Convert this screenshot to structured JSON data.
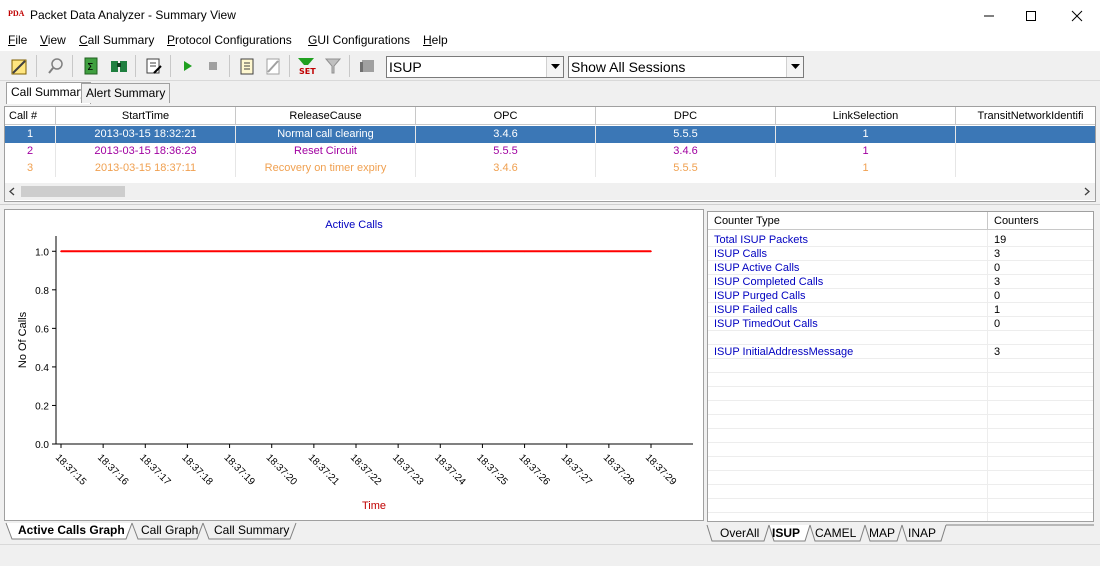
{
  "window": {
    "app_icon": "PDA",
    "title": "Packet Data Analyzer - Summary View"
  },
  "menu": [
    "File",
    "View",
    "Call Summary",
    "Protocol Configurations",
    "GUI Configurations",
    "Help"
  ],
  "toolbar": {
    "protocol_select": "ISUP",
    "session_select": "Show All Sessions"
  },
  "top_tabs": [
    "Call Summary",
    "Alert Summary"
  ],
  "call_table": {
    "columns": [
      "Call #",
      "StartTime",
      "ReleaseCause",
      "OPC",
      "DPC",
      "LinkSelection",
      "TransitNetworkIdentifi"
    ],
    "rows": [
      {
        "num": "1",
        "start": "2013-03-15 18:32:21",
        "cause": "Normal call clearing",
        "opc": "3.4.6",
        "dpc": "5.5.5",
        "link": "1",
        "color": "#ffffff"
      },
      {
        "num": "2",
        "start": "2013-03-15 18:36:23",
        "cause": "Reset Circuit",
        "opc": "5.5.5",
        "dpc": "3.4.6",
        "link": "1",
        "color": "#a000a0"
      },
      {
        "num": "3",
        "start": "2013-03-15 18:37:11",
        "cause": "Recovery on timer expiry",
        "opc": "3.4.6",
        "dpc": "5.5.5",
        "link": "1",
        "color": "#f0a050"
      }
    ]
  },
  "chart_data": {
    "type": "line",
    "title": "Active Calls",
    "xlabel": "Time",
    "ylabel": "No Of Calls",
    "x": [
      "18:37:15",
      "18:37:16",
      "18:37:17",
      "18:37:18",
      "18:37:19",
      "18:37:20",
      "18:37:21",
      "18:37:22",
      "18:37:23",
      "18:37:24",
      "18:37:25",
      "18:37:26",
      "18:37:27",
      "18:37:28",
      "18:37:29"
    ],
    "series": [
      {
        "values": [
          1,
          1,
          1,
          1,
          1,
          1,
          1,
          1,
          1,
          1,
          1,
          1,
          1,
          1,
          1
        ]
      }
    ],
    "yticks": [
      "0.0",
      "0.2",
      "0.4",
      "0.6",
      "0.8",
      "1.0"
    ],
    "ylim": [
      0,
      1.1
    ],
    "line_color": "#ff0000",
    "title_color": "#0000c0",
    "xlabel_color": "#c00000",
    "grid": false
  },
  "graph_tabs": [
    "Active Calls Graph",
    "Call Graph",
    "Call Summary"
  ],
  "counters": {
    "headers": [
      "Counter Type",
      "Counters"
    ],
    "rows": [
      {
        "type": "Total ISUP Packets",
        "value": "19"
      },
      {
        "type": "ISUP Calls",
        "value": "3"
      },
      {
        "type": "ISUP Active Calls",
        "value": "0"
      },
      {
        "type": "ISUP Completed Calls",
        "value": "3"
      },
      {
        "type": "ISUP Purged Calls",
        "value": "0"
      },
      {
        "type": "ISUP Failed calls",
        "value": "1"
      },
      {
        "type": "ISUP TimedOut Calls",
        "value": "0"
      },
      {
        "type": "",
        "value": ""
      },
      {
        "type": "ISUP InitialAddressMessage",
        "value": "3"
      }
    ]
  },
  "protocol_tabs": [
    "OverAll",
    "ISUP",
    "CAMEL",
    "MAP",
    "INAP"
  ]
}
